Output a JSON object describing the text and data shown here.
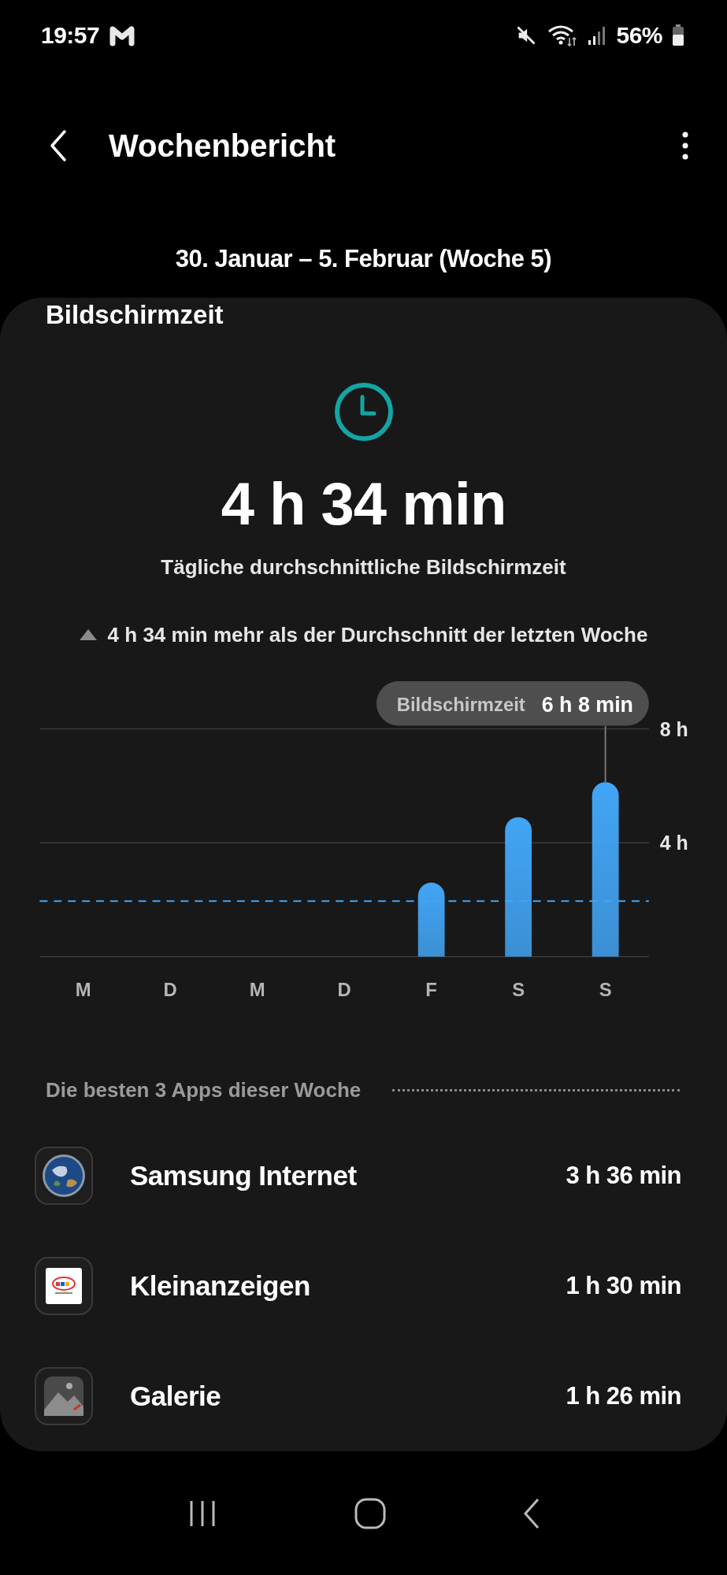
{
  "status_bar": {
    "time": "19:57",
    "battery": "56%"
  },
  "header": {
    "title": "Wochenbericht"
  },
  "date_range": "30. Januar – 5. Februar (Woche 5)",
  "section_title": "Bildschirmzeit",
  "summary": {
    "value": "4 h 34 min",
    "label": "Tägliche durchschnittliche Bildschirmzeit",
    "comparison": "4 h 34 min mehr als der Durchschnitt der letzten Woche"
  },
  "chart": {
    "tooltip": {
      "value": "6 h 8 min"
    },
    "chart_data": {
      "type": "bar",
      "categories": [
        "M",
        "D",
        "M",
        "D",
        "F",
        "S",
        "S"
      ],
      "series": [
        {
          "name": "Bildschirmzeit",
          "color": "#42a5f5",
          "values": [
            0,
            0,
            0,
            0,
            2.6,
            4.9,
            6.13
          ]
        }
      ],
      "ylim": [
        0,
        8
      ],
      "yticks": [
        {
          "value": 4,
          "label": "4 h"
        },
        {
          "value": 8,
          "label": "8 h"
        }
      ],
      "ref_lines": [
        {
          "axis": "y",
          "value": 1.95
        }
      ]
    }
  },
  "top_apps": {
    "title": "Die besten 3 Apps dieser Woche",
    "apps": [
      {
        "kind": "globe",
        "name": "Samsung Internet",
        "time": "3 h 36 min"
      },
      {
        "kind": "classifieds",
        "name": "Kleinanzeigen",
        "time": "1 h 30 min"
      },
      {
        "kind": "gallery",
        "name": "Galerie",
        "time": "1 h 26 min"
      }
    ]
  }
}
